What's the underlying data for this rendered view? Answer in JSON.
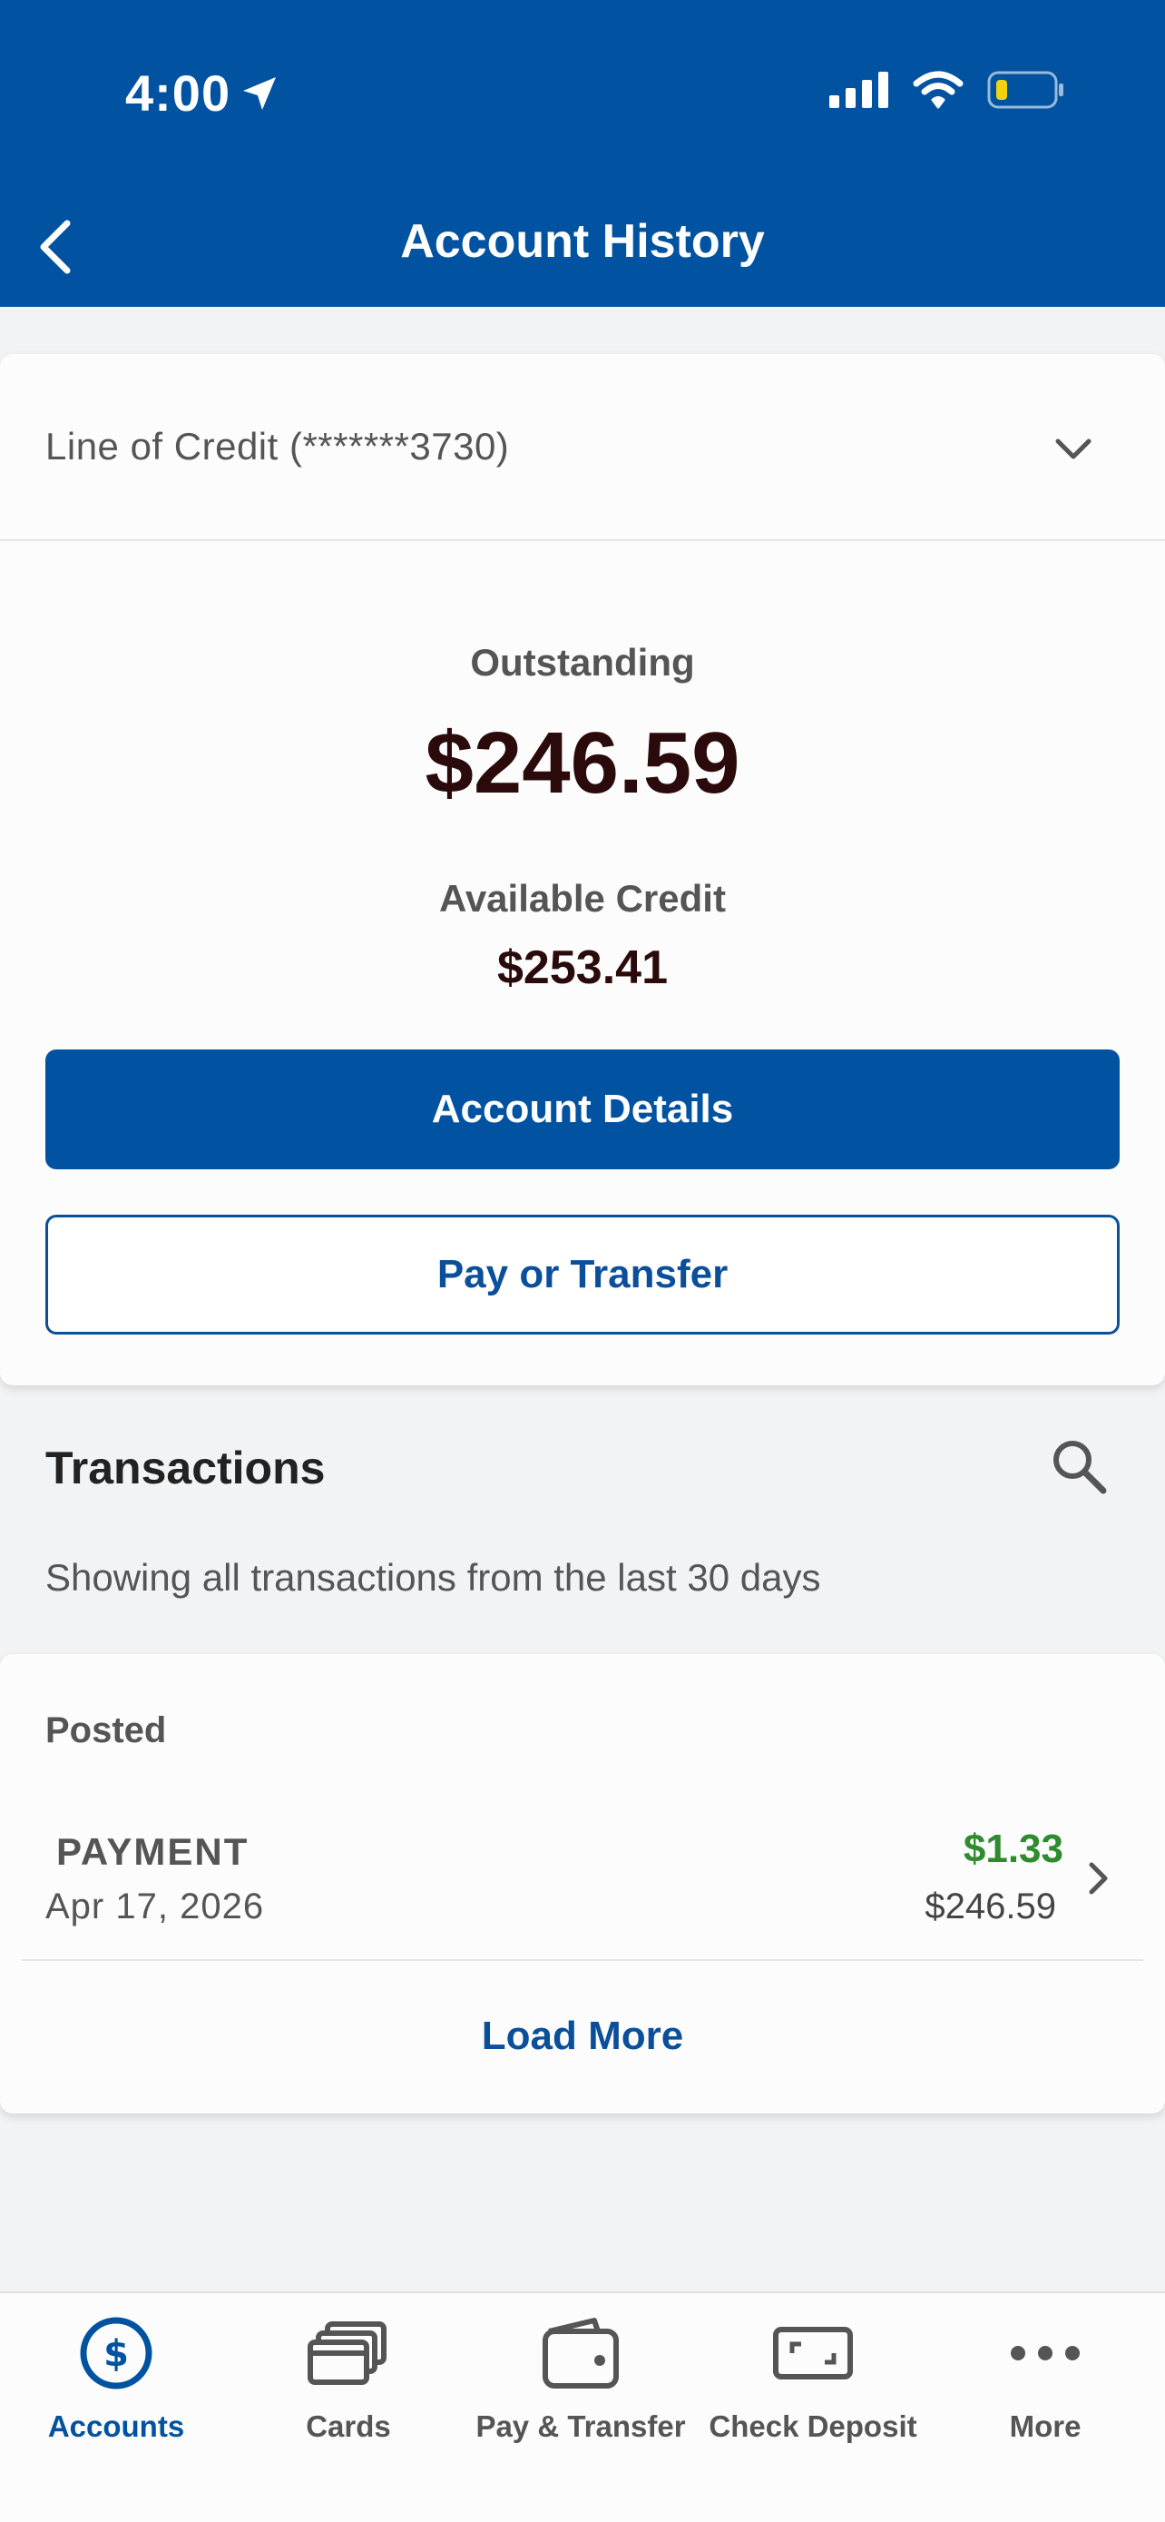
{
  "status_bar": {
    "time": "4:00"
  },
  "nav": {
    "title": "Account History"
  },
  "account": {
    "selector_label": "Line of Credit (*******3730)",
    "outstanding_label": "Outstanding",
    "outstanding_value": "$246.59",
    "available_label": "Available Credit",
    "available_value": "$253.41",
    "details_button": "Account Details",
    "pay_button": "Pay or Transfer"
  },
  "transactions": {
    "title": "Transactions",
    "note": "Showing all transactions from the last 30 days",
    "posted_label": "Posted",
    "items": [
      {
        "name": "PAYMENT",
        "date": "Apr 17, 2026",
        "amount": "$1.33",
        "balance": "$246.59"
      }
    ],
    "load_more": "Load More"
  },
  "tabbar": {
    "items": [
      {
        "label": "Accounts",
        "icon": "dollar-circle-icon",
        "active": true
      },
      {
        "label": "Cards",
        "icon": "cards-icon"
      },
      {
        "label": "Pay & Transfer",
        "icon": "wallet-icon"
      },
      {
        "label": "Check Deposit",
        "icon": "check-deposit-icon"
      },
      {
        "label": "More",
        "icon": "more-dots-icon"
      }
    ]
  },
  "colors": {
    "brand": "#0153a1",
    "credit_green": "#2e8b2e",
    "battery_low": "#f2d40e"
  }
}
